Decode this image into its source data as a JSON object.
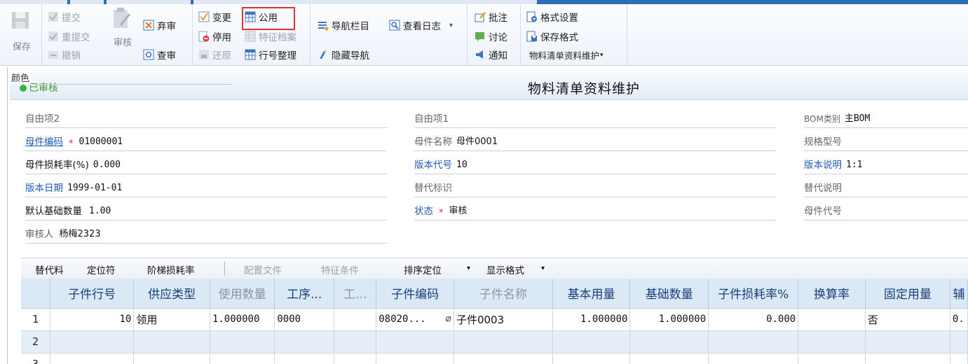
{
  "ribbon": {
    "save": "保存",
    "submit": "提交",
    "resubmit": "重提交",
    "revoke": "撤销",
    "audit": "审核",
    "abandon_audit": "弃审",
    "check_audit": "查审",
    "change": "变更",
    "disable": "停用",
    "restore": "还原",
    "public": "公用",
    "feature_archive": "特征档案",
    "row_arrange": "行号整理",
    "nav_bar": "导航栏目",
    "hide_nav": "隐藏导航",
    "view_log": "查看日志",
    "annotate": "批注",
    "discuss": "讨论",
    "notify": "通知",
    "format_settings": "格式设置",
    "save_format": "保存格式",
    "bom_maint_menu": "物料清单资料维护"
  },
  "header": {
    "title": "物料清单资料维护",
    "status_stamp": "已审核",
    "color_label": "颜色"
  },
  "form": {
    "free2_label": "自由项2",
    "parent_code_label": "母件编码",
    "parent_code": "01000001",
    "parent_loss_label": "母件损耗率(%)",
    "parent_loss": "0.000",
    "version_date_label": "版本日期",
    "version_date": "1999-01-01",
    "default_base_qty_label": "默认基础数量",
    "default_base_qty": "1.00",
    "auditor_label": "审核人",
    "auditor": "杨梅2323",
    "free1_label": "自由项1",
    "parent_name_label": "母件名称",
    "parent_name": "母件0001",
    "version_code_label": "版本代号",
    "version_code": "10",
    "replace_flag_label": "替代标识",
    "status_label": "状态",
    "status": "审核",
    "bom_type_label": "BOM类别",
    "bom_type": "主BOM",
    "spec_label": "规格型号",
    "version_desc_label": "版本说明",
    "version_desc": "1:1",
    "replace_desc_label": "替代说明",
    "parent_alias_label": "母件代号"
  },
  "grid_toolbar": {
    "substitute": "替代料",
    "locator": "定位符",
    "step_loss": "阶梯损耗率",
    "config_file": "配置文件",
    "feature_cond": "特征条件",
    "sort_locate": "排序定位",
    "display_format": "显示格式"
  },
  "grid": {
    "headers": [
      "",
      "子件行号",
      "供应类型",
      "使用数量",
      "工序...",
      "工...",
      "子件编码",
      "子件名称",
      "基本用量",
      "基础数量",
      "子件损耗率%",
      "换算率",
      "固定用量",
      "辅"
    ],
    "rows": [
      {
        "rn": "1",
        "line": "10",
        "supply": "领用",
        "use_qty": "1.000000",
        "proc": "0000",
        "proc2": "",
        "code": "08020...",
        "name": "子件0003",
        "base_use": "1.000000",
        "base_qty": "1.000000",
        "loss": "0.000",
        "conv": "",
        "fixed": "否",
        "aux": "0."
      },
      {
        "rn": "2"
      },
      {
        "rn": "3"
      }
    ]
  },
  "colors": {
    "accent_blue": "#2e6db5",
    "link_blue": "#1e5bb6",
    "required_red": "#e03030",
    "header_blue_bg": "#dbe8f6",
    "highlight_red": "#e03030"
  }
}
